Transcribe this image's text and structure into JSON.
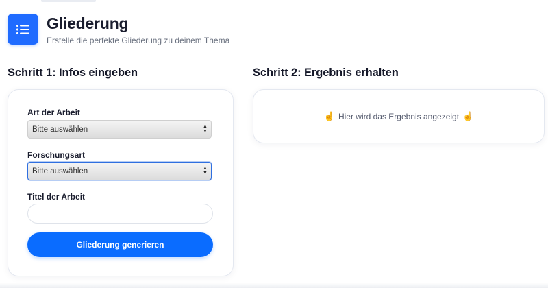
{
  "app": {
    "title": "Gliederung",
    "subtitle": "Erstelle die perfekte Gliederung zu deinem Thema",
    "icon": "list-icon",
    "accent_color": "#1f6bff"
  },
  "step1": {
    "heading": "Schritt 1: Infos eingeben",
    "fields": {
      "art": {
        "label": "Art der Arbeit",
        "value": "Bitte auswählen"
      },
      "forschung": {
        "label": "Forschungsart",
        "value": "Bitte auswählen"
      },
      "titel": {
        "label": "Titel der Arbeit",
        "value": "",
        "placeholder": ""
      }
    },
    "button_label": "Gliederung generieren"
  },
  "step2": {
    "heading": "Schritt 2: Ergebnis erhalten",
    "result_text": "Hier wird das Ergebnis angezeigt",
    "icon": "pointing-hand-icon",
    "emoji": "☝️"
  }
}
